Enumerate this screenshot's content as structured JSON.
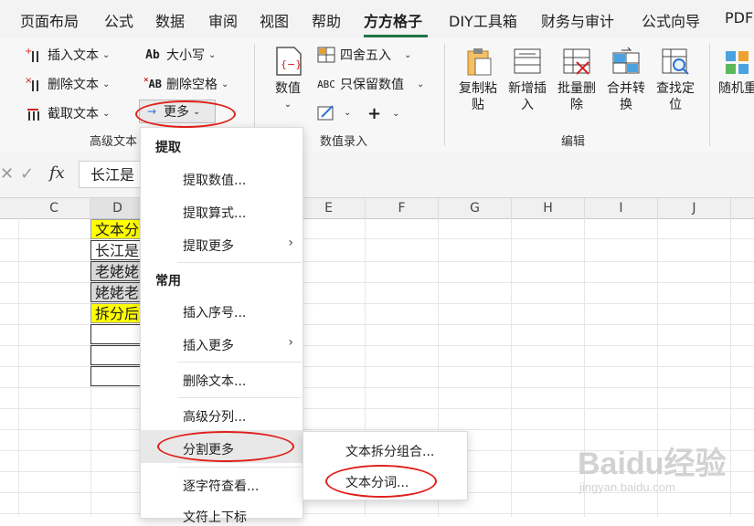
{
  "tabs": [
    {
      "label": "页面布局"
    },
    {
      "label": "公式"
    },
    {
      "label": "数据"
    },
    {
      "label": "审阅"
    },
    {
      "label": "视图"
    },
    {
      "label": "帮助"
    },
    {
      "label": "方方格子"
    },
    {
      "label": "DIY工具箱"
    },
    {
      "label": "财务与审计"
    },
    {
      "label": "公式向导"
    },
    {
      "label": "PDF"
    }
  ],
  "ribbon": {
    "text_group": {
      "insert_text": "插入文本",
      "delete_text": "删除文本",
      "extract_text": "截取文本",
      "case": "大小写",
      "delete_spaces": "删除空格",
      "more": "更多",
      "label": "高级文本"
    },
    "value_group": {
      "value_btn": "数值",
      "round": "四舍五入",
      "keep_values": "只保留数值",
      "label": "数值录入"
    },
    "edit_group": {
      "copy_paste": "复制粘贴",
      "insert_new": "新增插入",
      "batch_delete": "批量删除",
      "merge_convert": "合并转换",
      "find_locate": "查找定位",
      "random_repeat": "随机重复",
      "label": "编辑"
    }
  },
  "formula_bar": {
    "value": "长江是"
  },
  "columns": [
    "C",
    "D",
    "E",
    "F",
    "G",
    "H",
    "I",
    "J"
  ],
  "cells": [
    "文本分",
    "长江是",
    "老姥姥",
    "姥姥老",
    "拆分后"
  ],
  "menu": {
    "sections": [
      {
        "title": "提取",
        "items": [
          "提取数值...",
          "提取算式...",
          "提取更多"
        ]
      },
      {
        "title": "常用",
        "items": [
          "插入序号...",
          "插入更多",
          "删除文本...",
          "高级分列...",
          "分割更多",
          "逐字符查看...",
          "文符上下标"
        ]
      }
    ]
  },
  "submenu": {
    "items": [
      "文本拆分组合...",
      "文本分词..."
    ]
  },
  "watermark": {
    "main": "Baidu经验",
    "sub": "jingyan.baidu.com"
  },
  "colors": {
    "highlight_yellow": "#ffff00",
    "selection_gray": "#d9d9d9",
    "annotation_red": "#e0201b",
    "accent_green": "#217346"
  }
}
